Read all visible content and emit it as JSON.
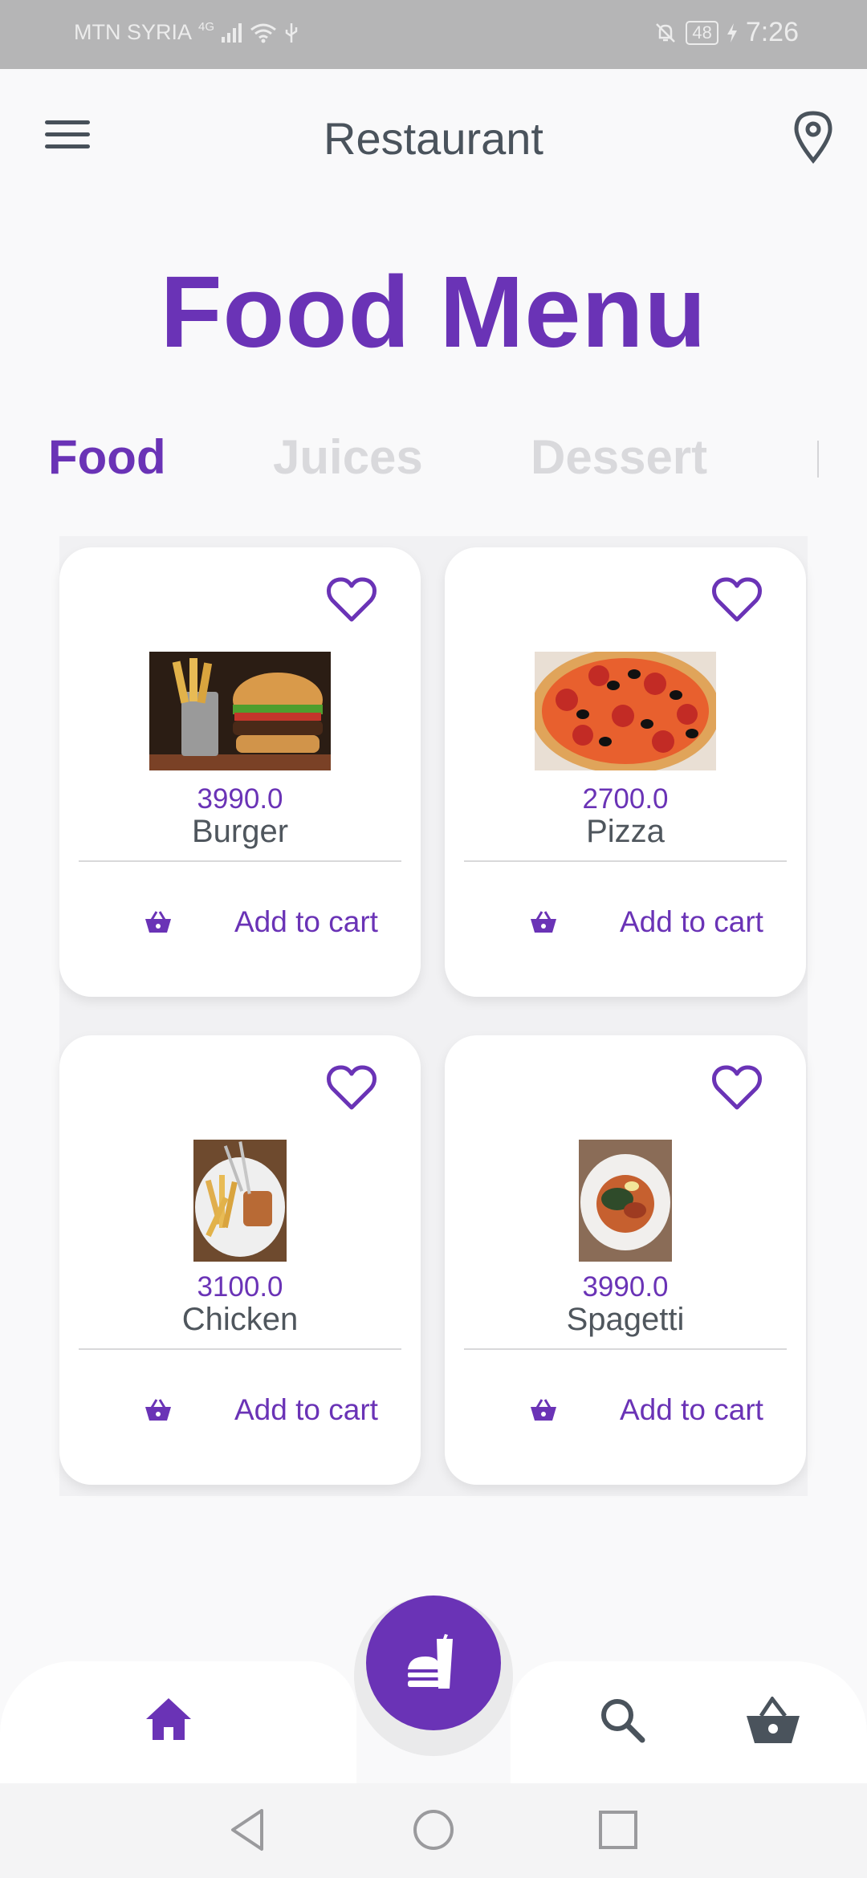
{
  "status_bar": {
    "carrier": "MTN SYRIA",
    "network": "4G",
    "battery": "48",
    "time": "7:26"
  },
  "app_bar": {
    "title": "Restaurant"
  },
  "headline": "Food Menu",
  "tabs": [
    {
      "label": "Food",
      "active": true
    },
    {
      "label": "Juices",
      "active": false
    },
    {
      "label": "Dessert",
      "active": false
    }
  ],
  "items": [
    {
      "price": "3990.0",
      "name": "Burger",
      "cart_label": "Add to cart",
      "image": "burger-photo"
    },
    {
      "price": "2700.0",
      "name": "Pizza",
      "cart_label": "Add to cart",
      "image": "pizza-photo"
    },
    {
      "price": "3100.0",
      "name": "Chicken",
      "cart_label": "Add to cart",
      "image": "chicken-photo"
    },
    {
      "price": "3990.0",
      "name": "Spagetti",
      "cart_label": "Add to cart",
      "image": "spaghetti-photo"
    }
  ],
  "bottom_nav": {
    "items": [
      "home-icon",
      "fastfood-icon",
      "search-icon",
      "basket-icon"
    ]
  },
  "colors": {
    "accent": "#6a33b6",
    "text": "#454d55",
    "inactive_tab": "#d9d9dc",
    "background": "#f9f9fa"
  }
}
